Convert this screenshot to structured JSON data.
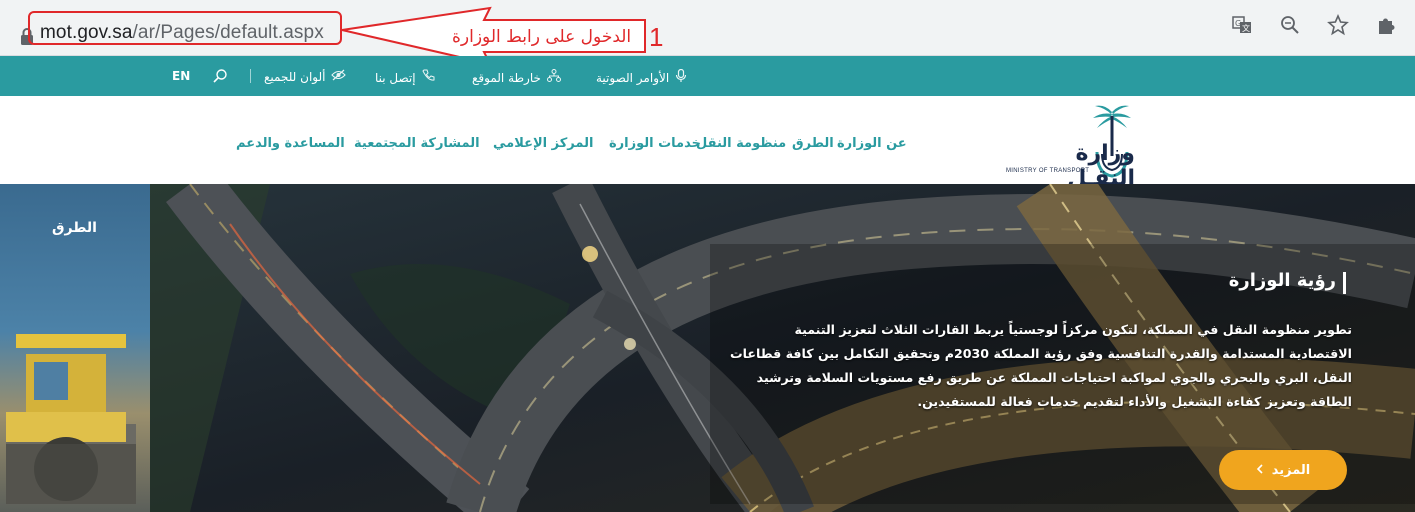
{
  "browser": {
    "url_host": "mot.gov.sa",
    "url_path": "/ar/Pages/default.aspx",
    "icons": [
      "translate-icon",
      "zoom-icon",
      "star-icon",
      "extension-icon"
    ]
  },
  "annotation": {
    "text": "الدخول على رابط الوزارة",
    "number": "1",
    "color": "#e0282a"
  },
  "utility_bar": {
    "voice_commands": "الأوامر الصوتية",
    "site_map": "خارطة الموقع",
    "contact": "إتصل بنا",
    "colors_for_all": "ألوان للجميع",
    "language": "EN",
    "color": "#2a9ba0"
  },
  "nav": {
    "items": [
      "عن الوزارة",
      "الطرق",
      "منظومة النقل",
      "خدمات الوزارة",
      "المركز الإعلامي",
      "المشاركة المجتمعية",
      "المساعدة والدعم"
    ]
  },
  "logo": {
    "name": "وزارة النقـل",
    "subtitle": "MINISTRY OF TRANSPORT"
  },
  "hero": {
    "side_title": "الطرق",
    "vision_title": "رؤية الوزارة",
    "vision_text": "تطوير منظومة النقل في المملكة، لتكون مركزاً لوجستياً يربط القارات الثلاث لتعزيز التنمية الاقتصادية المستدامة والقدرة التنافسية وفق رؤية المملكة 2030م وتحقيق التكامل بين كافة قطاعات النقل، البري والبحري والجوي لمواكبة احتياجات المملكة عن طريق رفع مستويات السلامة وترشيد الطاقة وتعزيز كفاءة التشغيل والأداء لتقديم خدمات فعالة للمستفيدين.",
    "more_button": "المزيد",
    "accent": "#f0a51e"
  }
}
